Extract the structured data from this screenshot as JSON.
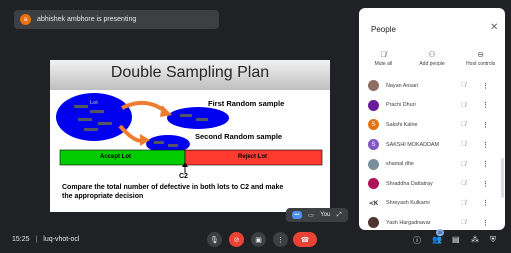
{
  "presenter": {
    "avatar_letter": "a",
    "text": "abhishek ambhore is presenting"
  },
  "slide": {
    "title": "Double Sampling Plan",
    "lot_label": "Lot",
    "first_sample_label": "First Random sample",
    "second_sample_label": "Second Random sample",
    "accept_label": "Accept Lot",
    "reject_label": "Reject Lot",
    "c2_label": "C2",
    "caption_line1": "Compare the total number of defective in both lots to C2 and make",
    "caption_line2": "the appropriate decision"
  },
  "self_view": {
    "pill": "•••",
    "you_label": "You"
  },
  "people_panel": {
    "title": "People",
    "actions": [
      {
        "icon": "mic-off-icon",
        "label": "Mute all"
      },
      {
        "icon": "add-person-icon",
        "label": "Add people"
      },
      {
        "icon": "host-controls-icon",
        "label": "Host controls"
      }
    ],
    "participants": [
      {
        "name": "Nayan Ansari",
        "avatar": "",
        "color": "#8d6e63"
      },
      {
        "name": "Prachi Dhuri",
        "avatar": "",
        "color": "#6a1b9a"
      },
      {
        "name": "Sakshi Kalne",
        "avatar": "S",
        "color": "#e8710a"
      },
      {
        "name": "SAKSHI MOKADDAM",
        "avatar": "S",
        "color": "#7e57c2"
      },
      {
        "name": "shamal dhe",
        "avatar": "",
        "color": "#78909c"
      },
      {
        "name": "Shraddha Dattatray",
        "avatar": "",
        "color": "#ad1457"
      },
      {
        "name": "Shreyash Kulkarni",
        "avatar": "≺K",
        "color": "#ffffff"
      },
      {
        "name": "Yash Hargadnavar",
        "avatar": "",
        "color": "#4e342e"
      }
    ]
  },
  "bottom_bar": {
    "time": "15:25",
    "separator": "|",
    "meeting_code": "luq-vhot-ocl",
    "people_count": "38"
  }
}
